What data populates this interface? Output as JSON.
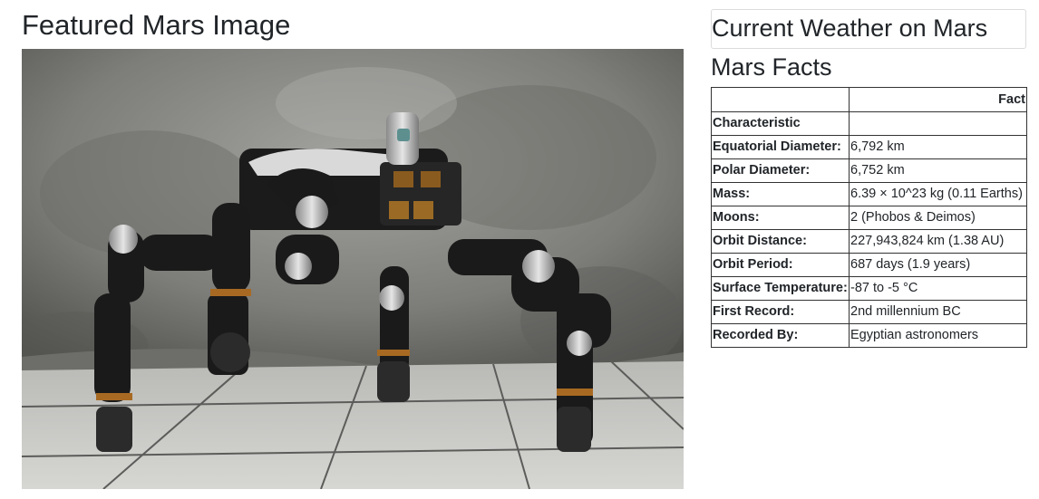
{
  "featured": {
    "title": "Featured Mars Image"
  },
  "weather": {
    "title": "Current Weather on Mars"
  },
  "facts": {
    "title": "Mars Facts",
    "header_blank": "",
    "header_col": "Fact",
    "index_label": "Characteristic",
    "rows": [
      {
        "label": "Equatorial Diameter:",
        "value": "6,792 km"
      },
      {
        "label": "Polar Diameter:",
        "value": "6,752 km"
      },
      {
        "label": "Mass:",
        "value": "6.39 × 10^23 kg (0.11 Earths)"
      },
      {
        "label": "Moons:",
        "value": "2 (Phobos & Deimos)"
      },
      {
        "label": "Orbit Distance:",
        "value": "227,943,824 km (1.38 AU)"
      },
      {
        "label": "Orbit Period:",
        "value": "687 days (1.9 years)"
      },
      {
        "label": "Surface Temperature:",
        "value": "-87 to -5 °C"
      },
      {
        "label": "First Record:",
        "value": "2nd millennium BC"
      },
      {
        "label": "Recorded By:",
        "value": "Egyptian astronomers"
      }
    ]
  }
}
